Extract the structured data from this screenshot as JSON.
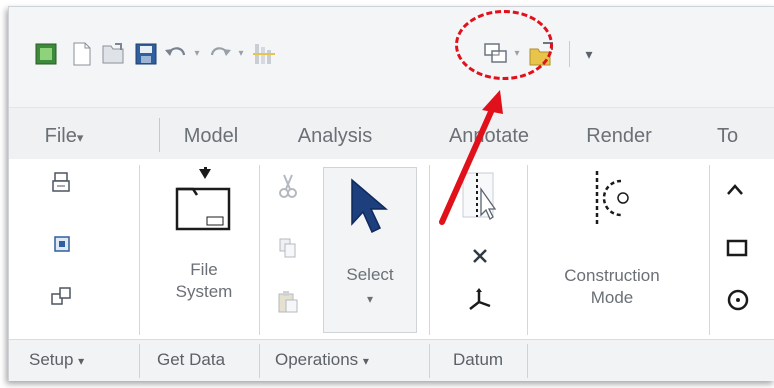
{
  "tabs": [
    {
      "label": "File",
      "has_dropdown": true
    },
    {
      "label": "Model"
    },
    {
      "label": "Analysis"
    },
    {
      "label": "Annotate"
    },
    {
      "label": "Render"
    },
    {
      "label": "To"
    }
  ],
  "ribbon": {
    "file_system": {
      "line1": "File",
      "line2": "System"
    },
    "select": {
      "label": "Select"
    },
    "construction_mode": {
      "line1": "Construction",
      "line2": "Mode"
    }
  },
  "groups": [
    {
      "label": "Setup",
      "has_dropdown": true
    },
    {
      "label": "Get Data"
    },
    {
      "label": "Operations",
      "has_dropdown": true
    },
    {
      "label": "Datum"
    }
  ],
  "dropdown_glyph": "▾",
  "colors": {
    "annotation": "#e0111b",
    "icon_blue": "#1f4e8c",
    "icon_green": "#58b04a",
    "folder_yellow": "#e8c44a"
  }
}
